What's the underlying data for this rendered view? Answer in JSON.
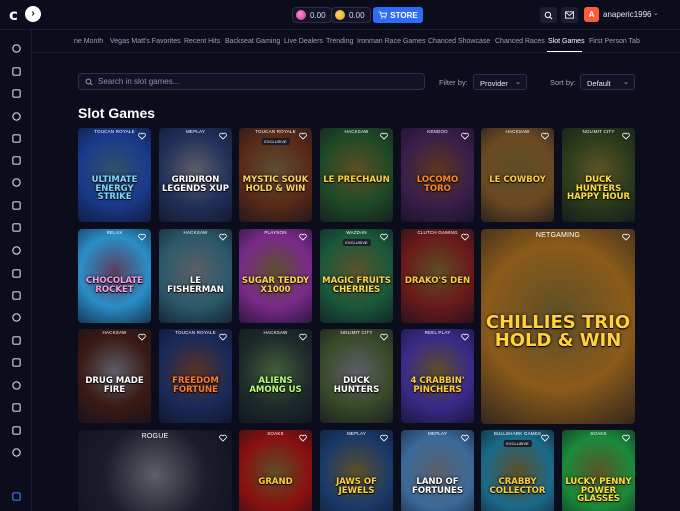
{
  "app": {
    "logo": "c",
    "username": "anaperic1996",
    "avatar_initial": "A",
    "store_label": "STORE"
  },
  "balances": [
    {
      "value": "0.00",
      "color": "#e35aad"
    },
    {
      "value": "0.00",
      "color": "#f0b43a"
    }
  ],
  "tabs": [
    {
      "label": "ne Month",
      "active": false
    },
    {
      "label": "Vegas Matt's Favorites",
      "active": false
    },
    {
      "label": "Recent Hits",
      "active": false
    },
    {
      "label": "Backseat Gaming",
      "active": false
    },
    {
      "label": "Live Dealers",
      "active": false
    },
    {
      "label": "Trending",
      "active": false
    },
    {
      "label": "Ironman Race Games",
      "active": false
    },
    {
      "label": "Chanced Showcase",
      "active": false
    },
    {
      "label": "Chanced Races",
      "active": false
    },
    {
      "label": "Slot Games",
      "active": true
    },
    {
      "label": "First Person Tab",
      "active": false
    }
  ],
  "search": {
    "placeholder": "Search in slot games..."
  },
  "filters": {
    "filter_label": "Filter by:",
    "filter_value": "Provider",
    "sort_label": "Sort by:",
    "sort_value": "Default"
  },
  "page_title": "Slot Games",
  "games": [
    {
      "provider": "TOUCAN ROYALE",
      "title": "ULTIMATE ENERGY STRIKE",
      "bg": "#1a3a8c",
      "fg": "#7fd8ff"
    },
    {
      "provider": "MEPLAY",
      "title": "GRIDIRON LEGENDS XUP",
      "bg": "#22305a",
      "fg": "#ffffff"
    },
    {
      "provider": "TOUCAN ROYALE",
      "badge": "EXCLUSIVE",
      "title": "MYSTIC SOUK HOLD & WIN",
      "bg": "#5a2a18",
      "fg": "#ffd35c"
    },
    {
      "provider": "HACKSAW",
      "title": "LE PRECHAUN",
      "bg": "#1f4a26",
      "fg": "#ffcf3a"
    },
    {
      "provider": "KENDOO",
      "title": "LOCOMO TORO",
      "bg": "#3a1e4a",
      "fg": "#ff8a1f"
    },
    {
      "provider": "HACKSAW",
      "title": "LE COWBOY",
      "bg": "#6b4a22",
      "fg": "#ffcf3a"
    },
    {
      "provider": "NOLIMIT CITY",
      "title": "DUCK HUNTERS HAPPY HOUR",
      "bg": "#2a3a1a",
      "fg": "#ffe03a"
    },
    {
      "provider": "RELAX",
      "title": "CHOCOLATE ROCKET",
      "bg": "#2a8ec8",
      "fg": "#ff9be0"
    },
    {
      "provider": "HACKSAW",
      "title": "LE FISHERMAN",
      "bg": "#2c5a6a",
      "fg": "#ffffff"
    },
    {
      "provider": "PLAYSON",
      "title": "SUGAR TEDDY X1000",
      "bg": "#7a2a8a",
      "fg": "#ffd84a"
    },
    {
      "provider": "WAZDAN",
      "badge": "EXCLUSIVE",
      "title": "MAGIC FRUITS CHERRIES",
      "bg": "#1a5a3a",
      "fg": "#ffd84a"
    },
    {
      "provider": "CLUTCH GAMING",
      "title": "DRAKO'S DEN",
      "bg": "#6a1a1a",
      "fg": "#ffcf3a"
    },
    {
      "provider": "NETGAMING",
      "title": "CHILLIES TRIO HOLD & WIN",
      "bg": "#8a5a1a",
      "fg": "#ffd23a"
    },
    {
      "provider": "HACKSAW",
      "title": "DRUG MADE FIRE",
      "bg": "#3a1a14",
      "fg": "#ffffff"
    },
    {
      "provider": "TOUCAN ROYALE",
      "title": "FREEDOM FORTUNE",
      "bg": "#1a2a5a",
      "fg": "#ff7a2a"
    },
    {
      "provider": "HACKSAW",
      "title": "ALIENS AMONG US",
      "bg": "#1e2a2a",
      "fg": "#b6ff7a"
    },
    {
      "provider": "NOLIMIT CITY",
      "title": "DUCK HUNTERS",
      "bg": "#3a4a2a",
      "fg": "#ffffff"
    },
    {
      "provider": "REEL PLAY",
      "title": "4 CRABBIN' PINCHERS",
      "bg": "#3a2a8a",
      "fg": "#ffcf3a"
    },
    {
      "provider": "ROGUE",
      "title": "",
      "bg": "#1a1c2a",
      "fg": "#ffffff"
    },
    {
      "provider": "SOAKS",
      "title": "GRAND",
      "bg": "#8a1010",
      "fg": "#ffd23a"
    },
    {
      "provider": "MEPLAY",
      "title": "JAWS OF JEWELS",
      "bg": "#1a3a6a",
      "fg": "#ffd23a"
    },
    {
      "provider": "MEPLAY",
      "title": "LAND OF FORTUNES",
      "bg": "#3a6a9a",
      "fg": "#ffffff"
    },
    {
      "provider": "BULLSHARK GAMES",
      "badge": "EXCLUSIVE",
      "title": "CRABBY COLLECTOR",
      "bg": "#1a6a8a",
      "fg": "#ffcf3a"
    },
    {
      "provider": "SOAKS",
      "title": "LUCKY PENNY POWER GLASSES",
      "bg": "#1a8a3a",
      "fg": "#ffe03a"
    }
  ],
  "sidebar_icons": [
    "pencil-icon",
    "search-icon",
    "clock-icon",
    "heart-icon",
    "flame-icon",
    "rocket-icon",
    "cards-icon",
    "dice-icon",
    "diamond-icon",
    "chip-icon",
    "slot-icon",
    "gamepad-icon",
    "gem-icon",
    "timer-icon",
    "sword-icon",
    "user-card-icon",
    "chart-icon",
    "trophy-icon",
    "flag-icon",
    "ticket-icon"
  ]
}
